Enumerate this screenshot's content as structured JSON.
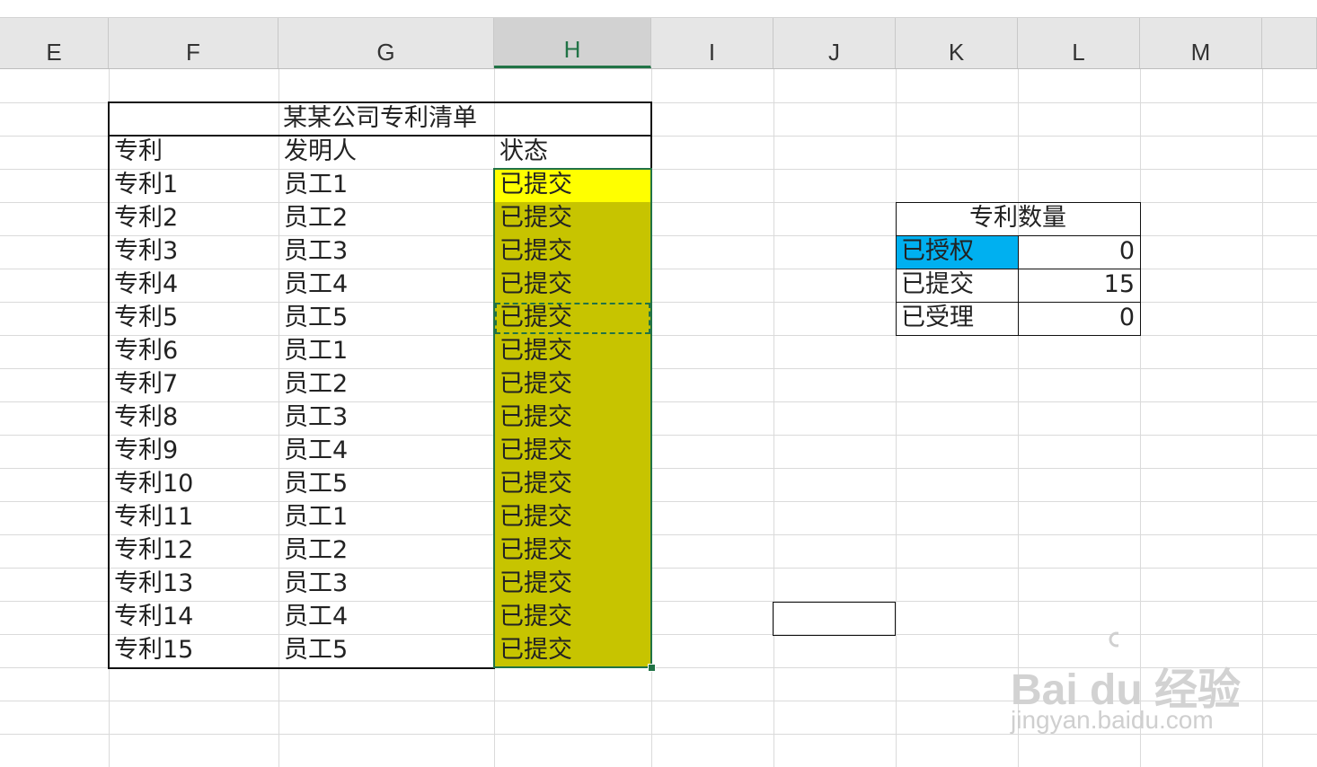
{
  "columns": [
    "E",
    "F",
    "G",
    "H",
    "I",
    "J",
    "K",
    "L",
    "M",
    ""
  ],
  "active_column": "H",
  "patent_table": {
    "title": "某某公司专利清单",
    "headers": [
      "专利",
      "发明人",
      "状态"
    ],
    "rows": [
      [
        "专利1",
        "员工1",
        "已提交"
      ],
      [
        "专利2",
        "员工2",
        "已提交"
      ],
      [
        "专利3",
        "员工3",
        "已提交"
      ],
      [
        "专利4",
        "员工4",
        "已提交"
      ],
      [
        "专利5",
        "员工5",
        "已提交"
      ],
      [
        "专利6",
        "员工1",
        "已提交"
      ],
      [
        "专利7",
        "员工2",
        "已提交"
      ],
      [
        "专利8",
        "员工3",
        "已提交"
      ],
      [
        "专利9",
        "员工4",
        "已提交"
      ],
      [
        "专利10",
        "员工5",
        "已提交"
      ],
      [
        "专利11",
        "员工1",
        "已提交"
      ],
      [
        "专利12",
        "员工2",
        "已提交"
      ],
      [
        "专利13",
        "员工3",
        "已提交"
      ],
      [
        "专利14",
        "员工4",
        "已提交"
      ],
      [
        "专利15",
        "员工5",
        "已提交"
      ]
    ]
  },
  "summary_table": {
    "title": "专利数量",
    "rows": [
      {
        "label": "已授权",
        "value": "0"
      },
      {
        "label": "已提交",
        "value": "15"
      },
      {
        "label": "已受理",
        "value": "0"
      }
    ]
  },
  "colors": {
    "status_fill": "#c7c400",
    "highlight_yellow": "#ffff00",
    "highlight_blue": "#00b0f0",
    "selection_green": "#217346"
  },
  "watermark": {
    "logo_text": "Bai du 经验",
    "url_text": "jingyan.baidu.com"
  }
}
